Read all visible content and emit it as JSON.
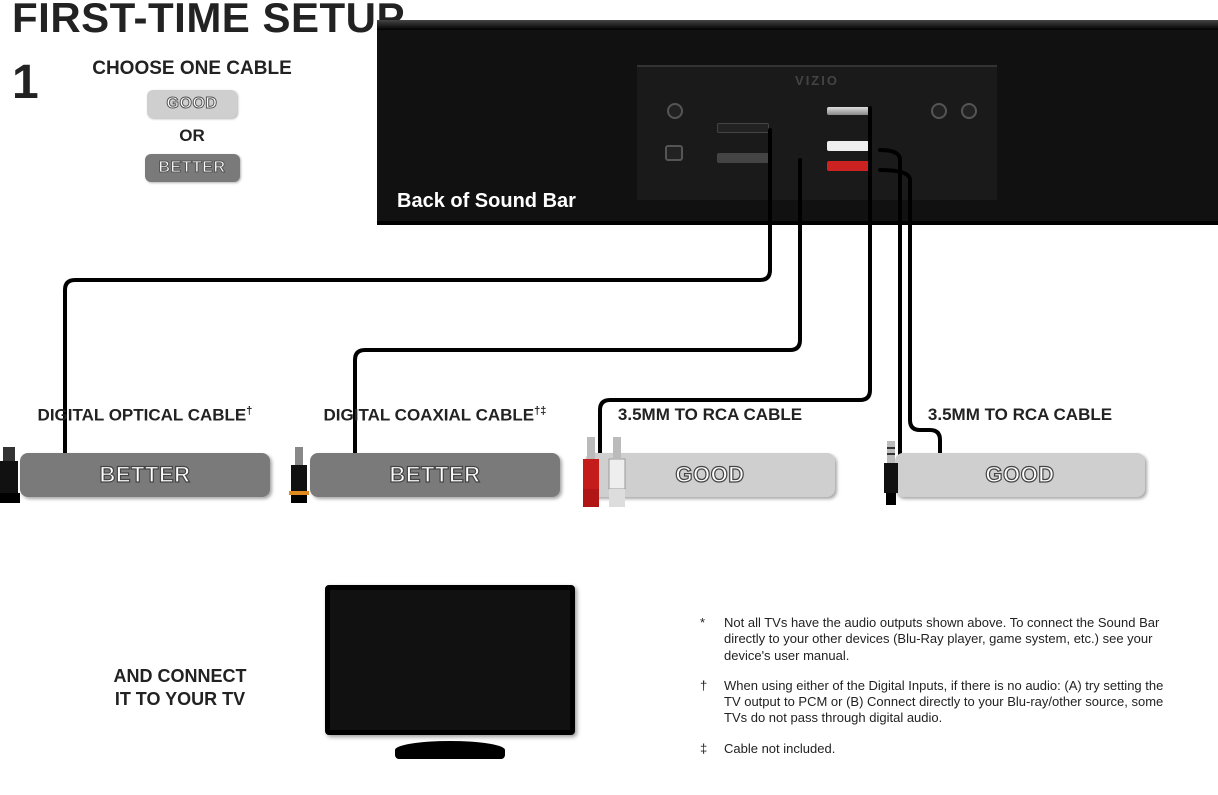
{
  "title": "FIRST-TIME SETUP",
  "step_number": "1",
  "choose": {
    "heading": "CHOOSE ONE CABLE",
    "good": "GOOD",
    "or": "OR",
    "better": "BETTER"
  },
  "soundbar": {
    "brand": "VIZIO",
    "label": "Back of Sound Bar"
  },
  "options": [
    {
      "label_html": "DIGITAL OPTICAL CABLE",
      "dagger": "†",
      "quality": "BETTER",
      "style": "better"
    },
    {
      "label_html": "DIGITAL COAXIAL CABLE",
      "dagger": "†‡",
      "quality": "BETTER",
      "style": "better"
    },
    {
      "label_html": "3.5MM TO RCA CABLE",
      "dagger": "",
      "quality": "GOOD",
      "style": "good"
    },
    {
      "label_html": "3.5MM TO RCA CABLE",
      "dagger": "",
      "quality": "GOOD",
      "style": "good"
    }
  ],
  "connect_text_line1": "AND CONNECT",
  "connect_text_line2": "IT TO YOUR TV",
  "footnotes": [
    {
      "symbol": "*",
      "text": "Not all TVs have the audio outputs shown above. To connect the Sound Bar directly to your other devices (Blu-Ray player, game system, etc.) see your device's user manual."
    },
    {
      "symbol": "†",
      "text": "When using either of the Digital Inputs, if there is no audio: (A) try setting the TV output to PCM or (B) Connect directly to your Blu-ray/other source, some TVs do not pass through digital audio."
    },
    {
      "symbol": "‡",
      "text": "Cable not included."
    }
  ]
}
